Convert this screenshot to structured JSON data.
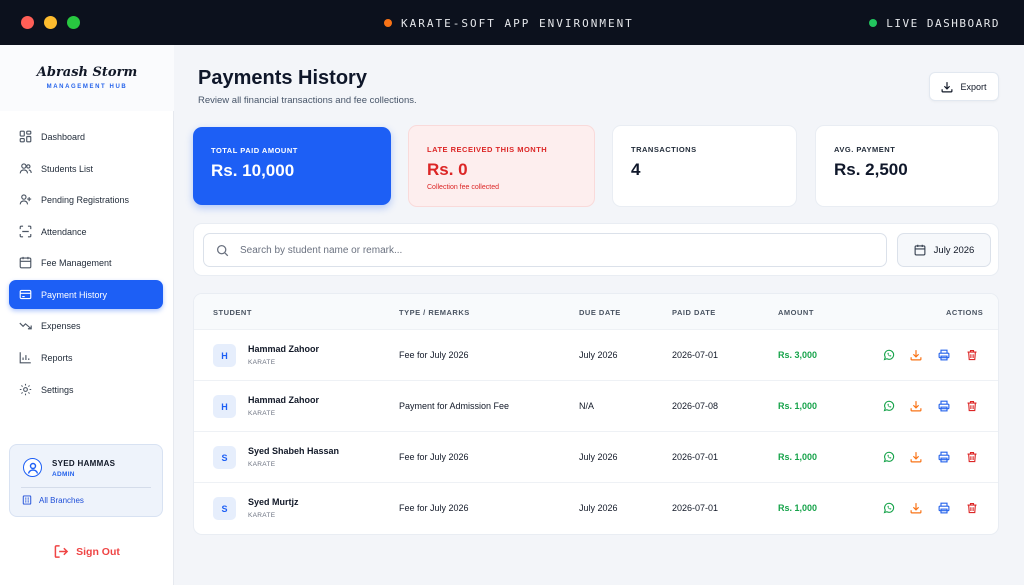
{
  "window": {
    "environment_label": "KARATE-SOFT APP ENVIRONMENT",
    "live_label": "LIVE DASHBOARD"
  },
  "brand": {
    "name": "Abrash Storm",
    "subtitle": "MANAGEMENT HUB"
  },
  "sidebar": {
    "items": [
      {
        "label": "Dashboard",
        "icon": "grid-icon"
      },
      {
        "label": "Students List",
        "icon": "users-icon"
      },
      {
        "label": "Pending Registrations",
        "icon": "user-plus-icon"
      },
      {
        "label": "Attendance",
        "icon": "scan-icon"
      },
      {
        "label": "Fee Management",
        "icon": "calendar-icon"
      },
      {
        "label": "Payment History",
        "icon": "credit-card-icon",
        "active": true
      },
      {
        "label": "Expenses",
        "icon": "trend-icon"
      },
      {
        "label": "Reports",
        "icon": "bar-chart-icon"
      },
      {
        "label": "Settings",
        "icon": "gear-icon"
      }
    ],
    "user": {
      "name": "SYED HAMMAS",
      "role": "ADMIN",
      "branches": "All Branches"
    },
    "sign_out": "Sign Out"
  },
  "header": {
    "title": "Payments History",
    "subtitle": "Review all financial transactions and fee collections.",
    "export_label": "Export"
  },
  "stats": {
    "total_paid": {
      "label": "TOTAL PAID AMOUNT",
      "value": "Rs. 10,000"
    },
    "late_received": {
      "label": "LATE RECEIVED THIS MONTH",
      "value": "Rs. 0",
      "note": "Collection fee collected"
    },
    "transactions": {
      "label": "TRANSACTIONS",
      "value": "4"
    },
    "avg_payment": {
      "label": "AVG. PAYMENT",
      "value": "Rs. 2,500"
    }
  },
  "filters": {
    "search_placeholder": "Search by student name or remark...",
    "month": "July 2026"
  },
  "table": {
    "headers": [
      "STUDENT",
      "TYPE / REMARKS",
      "DUE DATE",
      "PAID DATE",
      "AMOUNT",
      "ACTIONS"
    ],
    "rows": [
      {
        "initial": "H",
        "name": "Hammad Zahoor",
        "class": "KARATE",
        "remarks": "Fee for July 2026",
        "due": "July 2026",
        "paid": "2026-07-01",
        "amount": "Rs. 3,000"
      },
      {
        "initial": "H",
        "name": "Hammad Zahoor",
        "class": "KARATE",
        "remarks": "Payment for Admission Fee",
        "due": "N/A",
        "paid": "2026-07-08",
        "amount": "Rs. 1,000"
      },
      {
        "initial": "S",
        "name": "Syed Shabeh Hassan",
        "class": "KARATE",
        "remarks": "Fee for July 2026",
        "due": "July 2026",
        "paid": "2026-07-01",
        "amount": "Rs. 1,000"
      },
      {
        "initial": "S",
        "name": "Syed Murtjz",
        "class": "KARATE",
        "remarks": "Fee for July 2026",
        "due": "July 2026",
        "paid": "2026-07-01",
        "amount": "Rs. 1,000"
      }
    ],
    "action_icons": [
      "whatsapp-icon",
      "download-icon",
      "printer-icon",
      "trash-icon"
    ]
  },
  "colors": {
    "accent": "#1d5ff5",
    "danger": "#dc2626",
    "success": "#16a34a",
    "titlebar": "#0c111d"
  }
}
